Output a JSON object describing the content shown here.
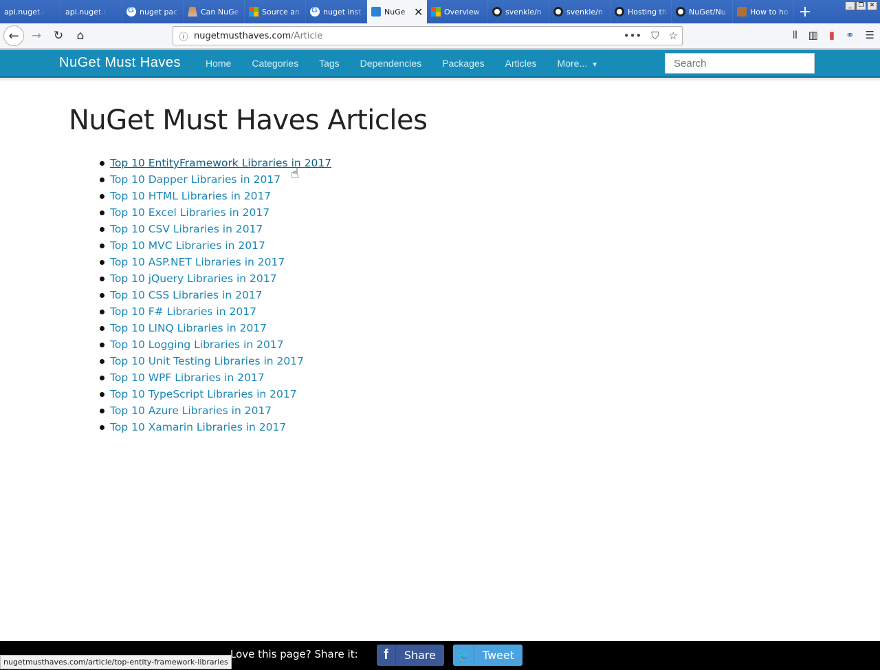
{
  "browser": {
    "tabs": [
      {
        "title": "api.nuget.org/",
        "favicon": "none"
      },
      {
        "title": "api.nuget.org/",
        "favicon": "none"
      },
      {
        "title": "nuget pac",
        "favicon": "google-icon"
      },
      {
        "title": "Can NuGe",
        "favicon": "stackoverflow-icon"
      },
      {
        "title": "Source an",
        "favicon": "microsoft-icon"
      },
      {
        "title": "nuget inst",
        "favicon": "google-icon"
      },
      {
        "title": "NuGe",
        "favicon": "nugetmusthaves-icon",
        "active": true
      },
      {
        "title": "Overview",
        "favicon": "microsoft-icon"
      },
      {
        "title": "svenkle/n",
        "favicon": "github-icon"
      },
      {
        "title": "svenkle/n",
        "favicon": "github-icon"
      },
      {
        "title": "Hosting th",
        "favicon": "github-icon"
      },
      {
        "title": "NuGet/Nu",
        "favicon": "github-icon"
      },
      {
        "title": "How to ho",
        "favicon": "user-avatar-icon"
      }
    ],
    "url_domain": "nugetmusthaves.com",
    "url_path": "/Article",
    "status_url": "nugetmusthaves.com/article/top-entity-framework-libraries"
  },
  "site": {
    "brand": "NuGet Must Haves",
    "nav": [
      "Home",
      "Categories",
      "Tags",
      "Dependencies",
      "Packages",
      "Articles",
      "More..."
    ],
    "search_placeholder": "Search",
    "accent_color": "#178cb9",
    "link_color": "#1a86b8"
  },
  "main": {
    "title": "NuGet Must Haves Articles",
    "articles": [
      "Top 10 EntityFramework Libraries in 2017",
      "Top 10 Dapper Libraries in 2017",
      "Top 10 HTML Libraries in 2017",
      "Top 10 Excel Libraries in 2017",
      "Top 10 CSV Libraries in 2017",
      "Top 10 MVC Libraries in 2017",
      "Top 10 ASP.NET Libraries in 2017",
      "Top 10 jQuery Libraries in 2017",
      "Top 10 CSS Libraries in 2017",
      "Top 10 F# Libraries in 2017",
      "Top 10 LINQ Libraries in 2017",
      "Top 10 Logging Libraries in 2017",
      "Top 10 Unit Testing Libraries in 2017",
      "Top 10 WPF Libraries in 2017",
      "Top 10 TypeScript Libraries in 2017",
      "Top 10 Azure Libraries in 2017",
      "Top 10 Xamarin Libraries in 2017"
    ],
    "hovered_index": 0
  },
  "footer": {
    "share_text": "Love this page? Share it:",
    "facebook_label": "Share",
    "twitter_label": "Tweet"
  }
}
